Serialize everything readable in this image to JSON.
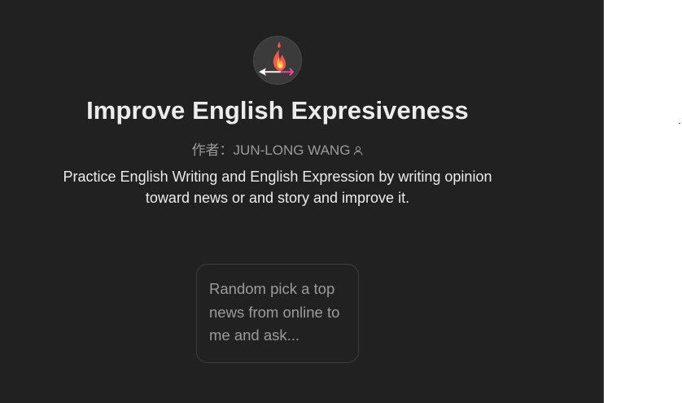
{
  "gpt": {
    "title": "Improve English Expresiveness",
    "author": "作者：JUN-LONG WANG",
    "description": "Practice English Writing and English Expression by writing opinion toward news or and story and improve it."
  },
  "conversation_starters": [
    {
      "label": "Random pick a top news from online to me and ask..."
    }
  ],
  "icons": {
    "avatar": "fire-arrow-icon",
    "author_badge": "person-icon"
  },
  "colors": {
    "panel_background": "#212121",
    "title_text": "#ececec",
    "muted_text": "#9b9b9b"
  }
}
